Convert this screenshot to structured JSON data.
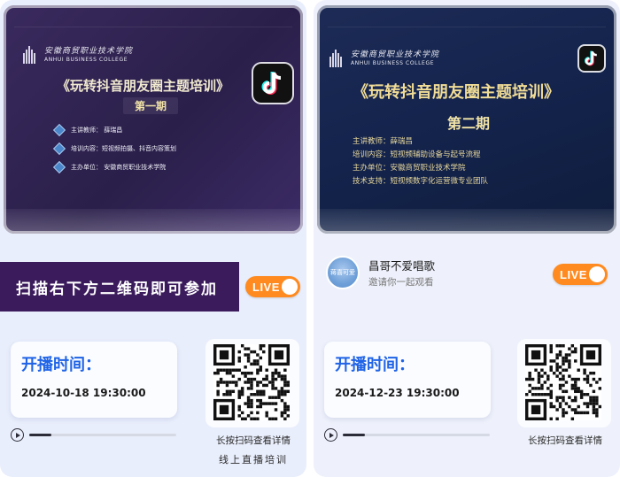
{
  "left": {
    "slide": {
      "logo_cn": "安徽商贸职业技术学院",
      "logo_en": "ANHUI BUSINESS COLLEGE",
      "title": "《玩转抖音朋友圈主题培训》",
      "episode": "第一期",
      "info": [
        "主讲教师：  薛瑞昌",
        "培训内容：短视频拍摄、抖音内容策划",
        "主办单位：  安徽商贸职业技术学院"
      ]
    },
    "banner_text": "扫描右下方二维码即可参加",
    "live_label": "LIVE",
    "time_label": "开播时间：",
    "time_value": "2024-10-18 19:30:00",
    "progress": 0.15,
    "qr_caption_1": "长按扫码查看详情",
    "qr_caption_2": "线上直播培训"
  },
  "right": {
    "slide": {
      "logo_cn": "安徽商贸职业技术学院",
      "logo_en": "ANHUI BUSINESS COLLEGE",
      "title": "《玩转抖音朋友圈主题培训》",
      "episode": "第二期",
      "info": [
        "主讲教师：薛瑞昌",
        "培训内容：短视频辅助设备与起号流程",
        "主办单位：安徽商贸职业技术学院",
        "技术支持：短视频数字化运营微专业团队"
      ]
    },
    "host_avatar_text": "蒋喜可爱",
    "host_name": "昌哥不爱唱歌",
    "host_sub": "邀请你一起观看",
    "live_label": "LIVE",
    "time_label": "开播时间：",
    "time_value": "2024-12-23 19:30:00",
    "progress": 0.15,
    "qr_caption_1": "长按扫码查看详情"
  },
  "colors": {
    "accent_blue": "#1f63e6",
    "live_orange": "#ff8a1f",
    "banner_purple": "#3b1b5c"
  },
  "icons": {
    "brand": "tiktok-icon",
    "play": "play-icon",
    "info_bullet": "diamond-icon"
  }
}
